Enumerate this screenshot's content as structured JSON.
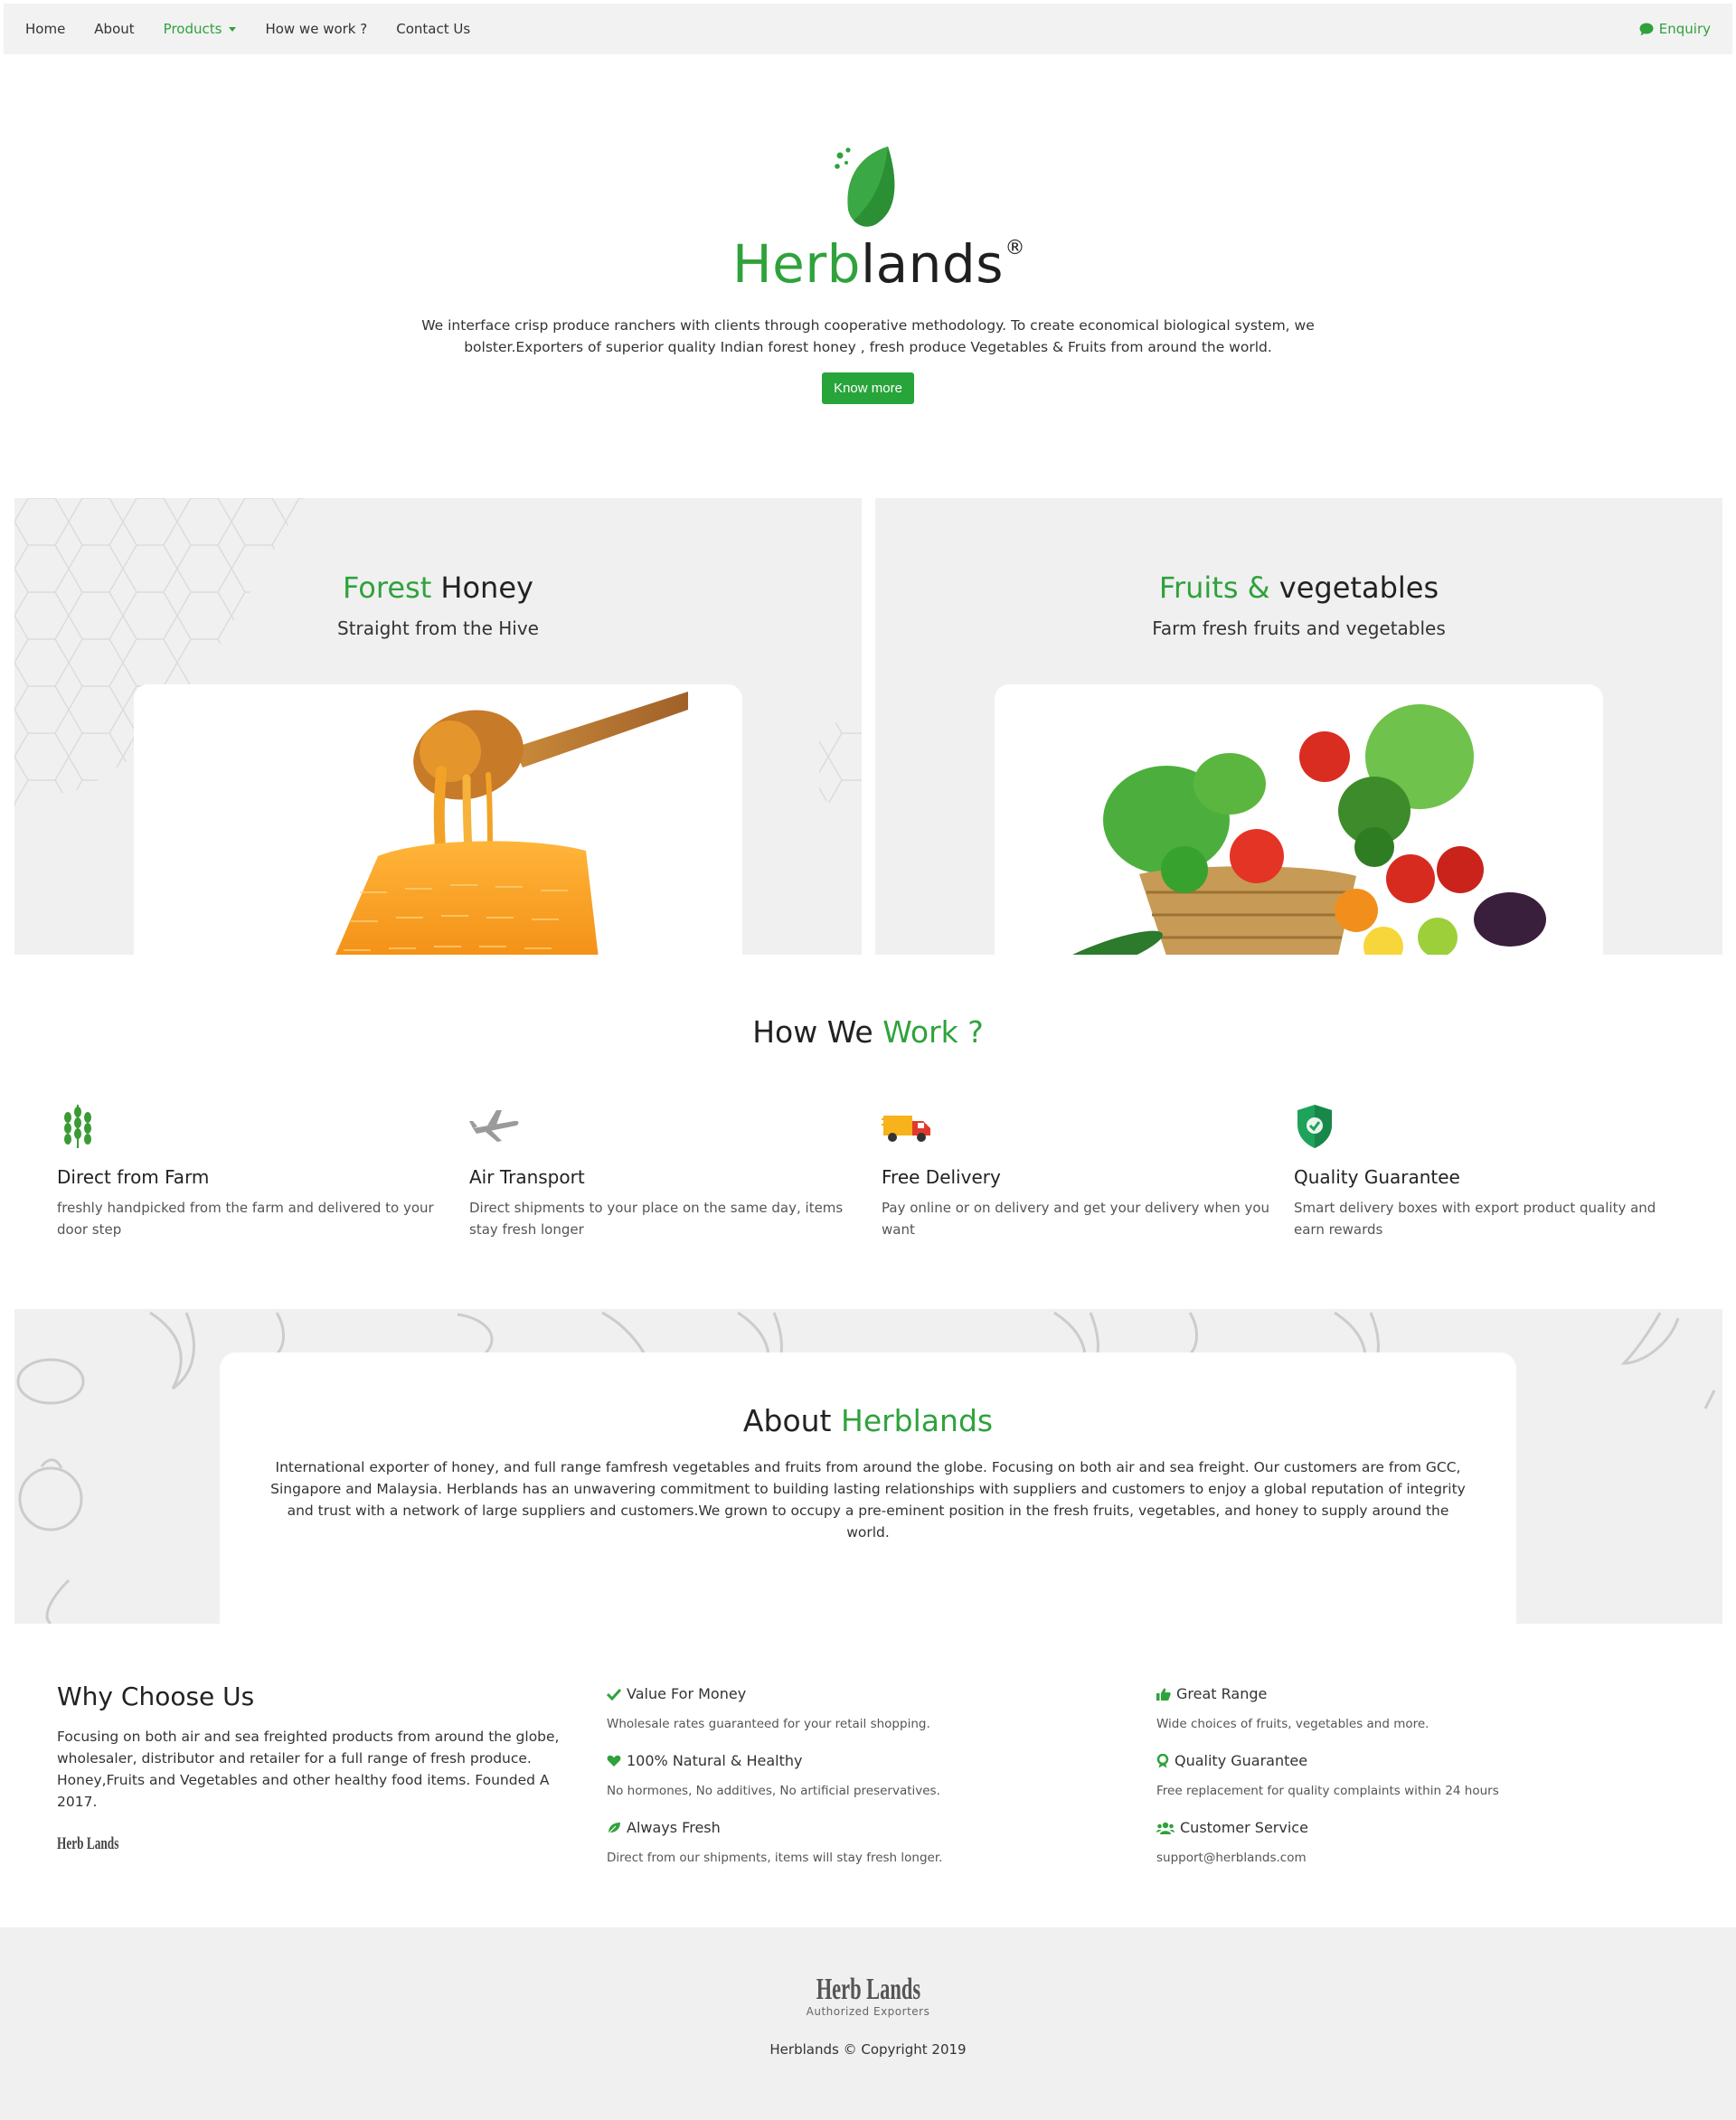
{
  "nav": {
    "items": [
      {
        "label": "Home"
      },
      {
        "label": "About"
      },
      {
        "label": "Products"
      },
      {
        "label": "How we work ?"
      },
      {
        "label": "Contact Us"
      }
    ],
    "enquiry_label": "Enquiry"
  },
  "hero": {
    "brand_green": "Herb",
    "brand_dark": "lands",
    "registered": "®",
    "text": "We interface crisp produce ranchers with clients through cooperative methodology. To create economical biological system, we bolster.Exporters of superior quality Indian forest honey , fresh produce Vegetables & Fruits from around the world.",
    "button_label": "Know more"
  },
  "products": {
    "honey": {
      "title_green": "Forest",
      "title_dark": "Honey",
      "subtitle": "Straight from the Hive"
    },
    "fruits": {
      "title_green": "Fruits &",
      "title_dark": "vegetables",
      "subtitle": "Farm fresh fruits and vegetables"
    }
  },
  "how": {
    "title_dark": "How We",
    "title_green": "Work ?",
    "features": [
      {
        "icon": "wheat-icon",
        "title": "Direct from Farm",
        "text": "freshly handpicked from the farm and delivered to your door step"
      },
      {
        "icon": "airplane-icon",
        "title": "Air Transport",
        "text": "Direct shipments to your place on the same day, items stay fresh longer"
      },
      {
        "icon": "delivery-truck-icon",
        "title": "Free Delivery",
        "text": "Pay online or on delivery and get your delivery when you want"
      },
      {
        "icon": "shield-check-icon",
        "title": "Quality Guarantee",
        "text": "Smart delivery boxes with export product quality and earn rewards"
      }
    ]
  },
  "about": {
    "title_dark": "About",
    "title_green": "Herblands",
    "text": "International exporter of honey, and full range famfresh vegetables and fruits from around the globe. Focusing on both air and sea freight. Our customers are from GCC, Singapore and Malaysia. Herblands has an unwavering commitment to building lasting relationships with suppliers and customers to enjoy a global reputation of integrity and trust with a network of large suppliers and customers.We grown to occupy a pre-eminent position in the fresh fruits, vegetables, and honey to supply around the world."
  },
  "why": {
    "title": "Why Choose Us",
    "text": "Focusing on both air and sea freighted products from around the globe, wholesaler, distributor and retailer for a full range of fresh produce. Honey,Fruits and Vegetables and other healthy food items. Founded A 2017.",
    "logo_text": "Herb Lands",
    "benefits": [
      {
        "icon": "check-icon",
        "title": "Value For Money",
        "text": "Wholesale rates guaranteed for your retail shopping."
      },
      {
        "icon": "heart-icon",
        "title": "100% Natural & Healthy",
        "text": "No hormones, No additives, No artificial preservatives."
      },
      {
        "icon": "leaf-icon",
        "title": "Always Fresh",
        "text": "Direct from our shipments, items will stay fresh longer."
      },
      {
        "icon": "thumbs-up-icon",
        "title": "Great Range",
        "text": "Wide choices of fruits, vegetables and more."
      },
      {
        "icon": "award-icon",
        "title": "Quality Guarantee",
        "text": "Free replacement for quality complaints within 24 hours"
      },
      {
        "icon": "users-icon",
        "title": "Customer Service",
        "text": "support@herblands.com"
      }
    ]
  },
  "footer": {
    "logo_text": "Herb Lands",
    "tagline": "Authorized Exporters",
    "copyright": "Herblands © Copyright 2019"
  },
  "colors": {
    "accent": "#2fa23c",
    "panel_bg": "#f0f0f0",
    "nav_bg": "#f2f2f2"
  }
}
